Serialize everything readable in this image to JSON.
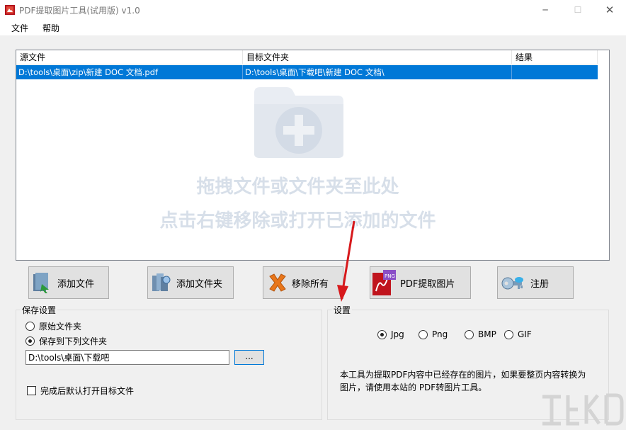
{
  "window": {
    "title": "PDF提取图片工具(试用版) v1.0",
    "controls": {
      "minimize": "─",
      "maximize": "☐",
      "close": "✕"
    }
  },
  "menu": [
    "文件",
    "帮助"
  ],
  "list": {
    "columns": [
      "源文件",
      "目标文件夹",
      "结果"
    ],
    "rows": [
      {
        "source": "D:\\tools\\桌面\\zip\\新建 DOC 文档.pdf",
        "target": "D:\\tools\\桌面\\下载吧\\新建 DOC 文档\\",
        "result": ""
      }
    ],
    "hint_line1": "拖拽文件或文件夹至此处",
    "hint_line2": "点击右键移除或打开已添加的文件"
  },
  "buttons": {
    "add_file": "添加文件",
    "add_folder": "添加文件夹",
    "remove_all": "移除所有",
    "extract": "PDF提取图片",
    "register": "注册"
  },
  "save_settings": {
    "label": "保存设置",
    "option_original": "原始文件夹",
    "option_custom": "保存到下列文件夹",
    "selected": "option_custom",
    "path": "D:\\tools\\桌面\\下载吧",
    "browse": "...",
    "open_after": "完成后默认打开目标文件",
    "open_after_checked": false
  },
  "settings": {
    "label": "设置",
    "formats": [
      "Jpg",
      "Png",
      "BMP",
      "GIF"
    ],
    "selected_format": "Jpg",
    "description": "本工具为提取PDF内容中已经存在的图片，如果要整页内容转换为图片，请使用本站的 PDF转图片工具。"
  },
  "colors": {
    "selection": "#0078d7",
    "annotation_arrow": "#d7191c"
  }
}
